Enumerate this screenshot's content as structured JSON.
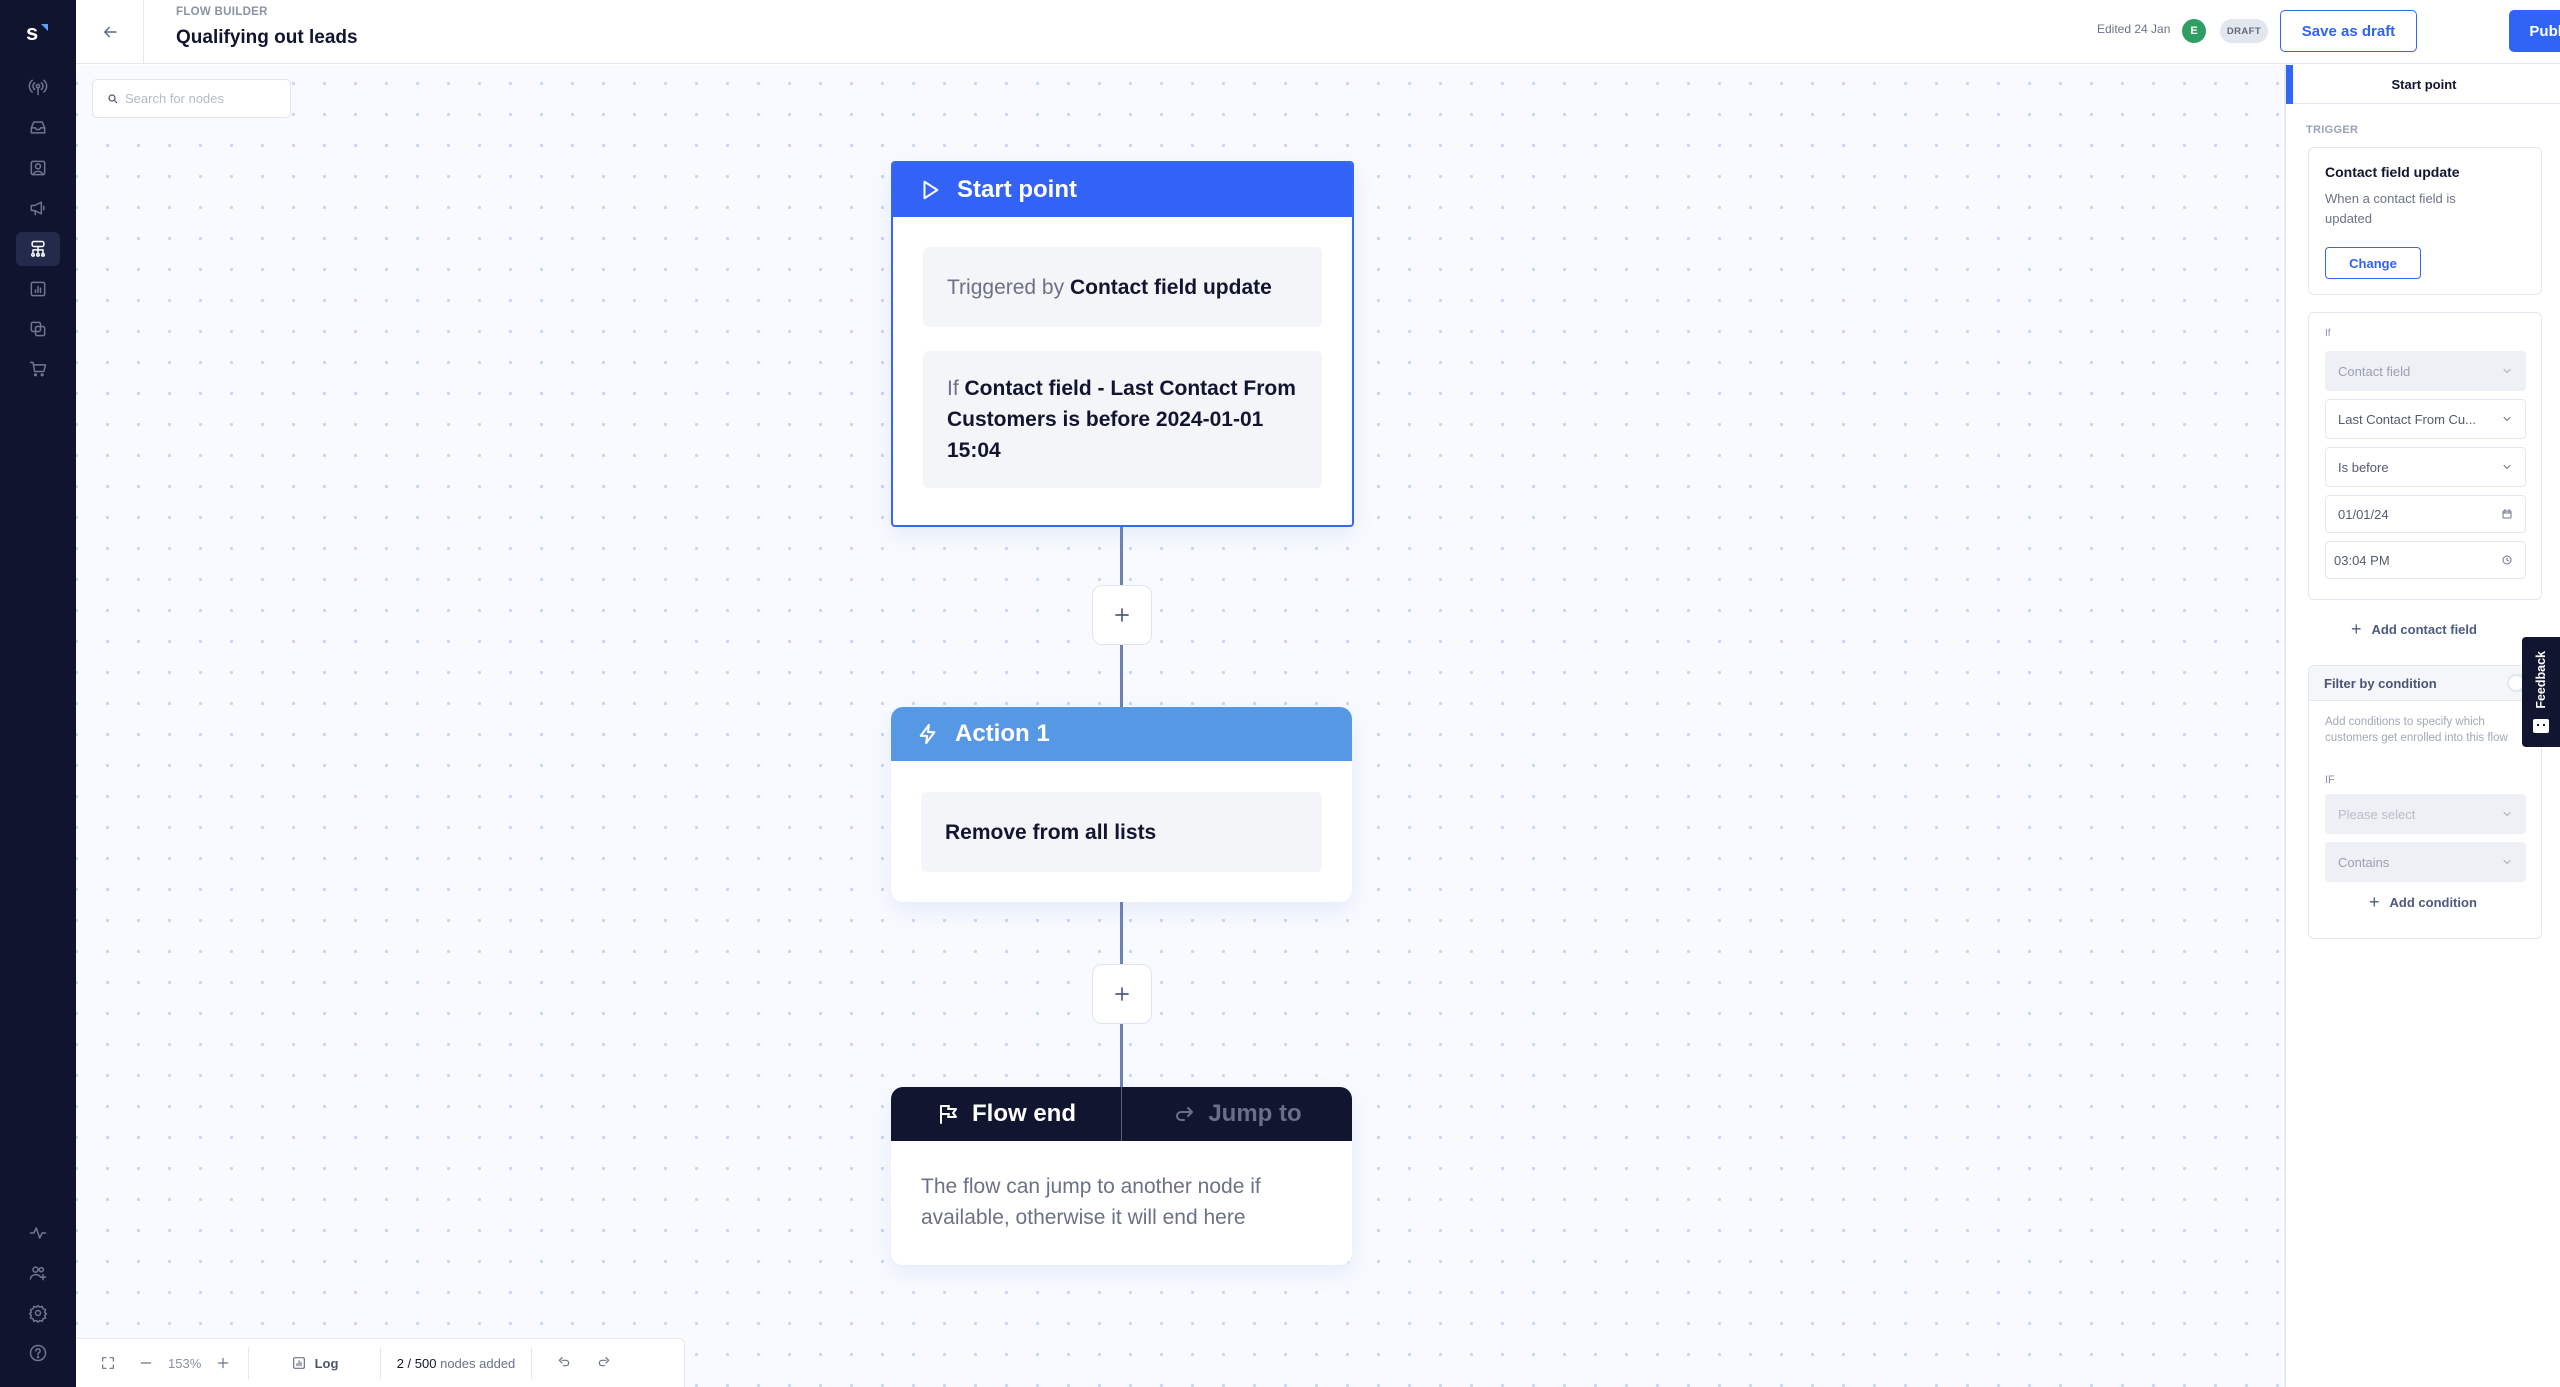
{
  "app": {
    "logo_letter": "s"
  },
  "nav": {
    "items": [
      {
        "name": "broadcast",
        "icon": "broadcast-icon",
        "active": false
      },
      {
        "name": "inbox",
        "icon": "inbox-icon",
        "active": false
      },
      {
        "name": "contacts",
        "icon": "contact-card-icon",
        "active": false
      },
      {
        "name": "campaigns",
        "icon": "megaphone-icon",
        "active": false
      },
      {
        "name": "flow-builder",
        "icon": "flow-icon",
        "active": true
      },
      {
        "name": "reports",
        "icon": "chart-icon",
        "active": false
      },
      {
        "name": "integrations",
        "icon": "overlap-squares-icon",
        "active": false
      },
      {
        "name": "commerce",
        "icon": "cart-icon",
        "active": false
      }
    ],
    "bottom_items": [
      {
        "name": "activity",
        "icon": "activity-icon"
      },
      {
        "name": "invite-users",
        "icon": "add-user-icon"
      },
      {
        "name": "settings",
        "icon": "gear-icon"
      },
      {
        "name": "help",
        "icon": "help-icon"
      }
    ]
  },
  "header": {
    "breadcrumb": "FLOW BUILDER",
    "title": "Qualifying out leads",
    "edited": "Edited 24 Jan",
    "avatar_initial": "E",
    "avatar_color": "#2f9e63",
    "status_badge": "DRAFT",
    "save_draft_label": "Save as draft",
    "publish_label": "Publish",
    "accent_color": "#2f64f5"
  },
  "canvas": {
    "search_placeholder": "Search for nodes",
    "nodes": {
      "start": {
        "title": "Start point",
        "trigger_prefix": "Triggered by",
        "trigger_value": "Contact field update",
        "condition_prefix": "If",
        "condition_value": "Contact field - Last Contact From Customers is before 2024-01-01 15:04"
      },
      "action": {
        "title": "Action 1",
        "body": "Remove from all lists"
      },
      "end": {
        "tab_active": "Flow end",
        "tab_inactive": "Jump to",
        "body": "The flow can jump to another node if available, otherwise it will end here"
      }
    },
    "toolbar": {
      "zoom": "153%",
      "log_label": "Log",
      "nodes_count": "2 / 500",
      "nodes_suffix": "nodes added"
    }
  },
  "panel": {
    "tab": "Start point",
    "trigger_label": "TRIGGER",
    "trigger_title": "Contact field update",
    "trigger_desc": "When a contact field is updated",
    "change_label": "Change",
    "if_label": "If",
    "fields": {
      "type": "Contact field",
      "field": "Last Contact From Cu...",
      "operator": "Is before",
      "date": "01/01/24",
      "time": "03:04 PM"
    },
    "add_contact_field": "Add contact field",
    "filter": {
      "title": "Filter by condition",
      "enabled": false,
      "desc": "Add conditions to specify which customers get enrolled into this flow",
      "if_label": "IF",
      "select_placeholder": "Please select",
      "operator": "Contains",
      "add_condition": "Add condition"
    }
  },
  "feedback": {
    "label": "Feedback"
  }
}
